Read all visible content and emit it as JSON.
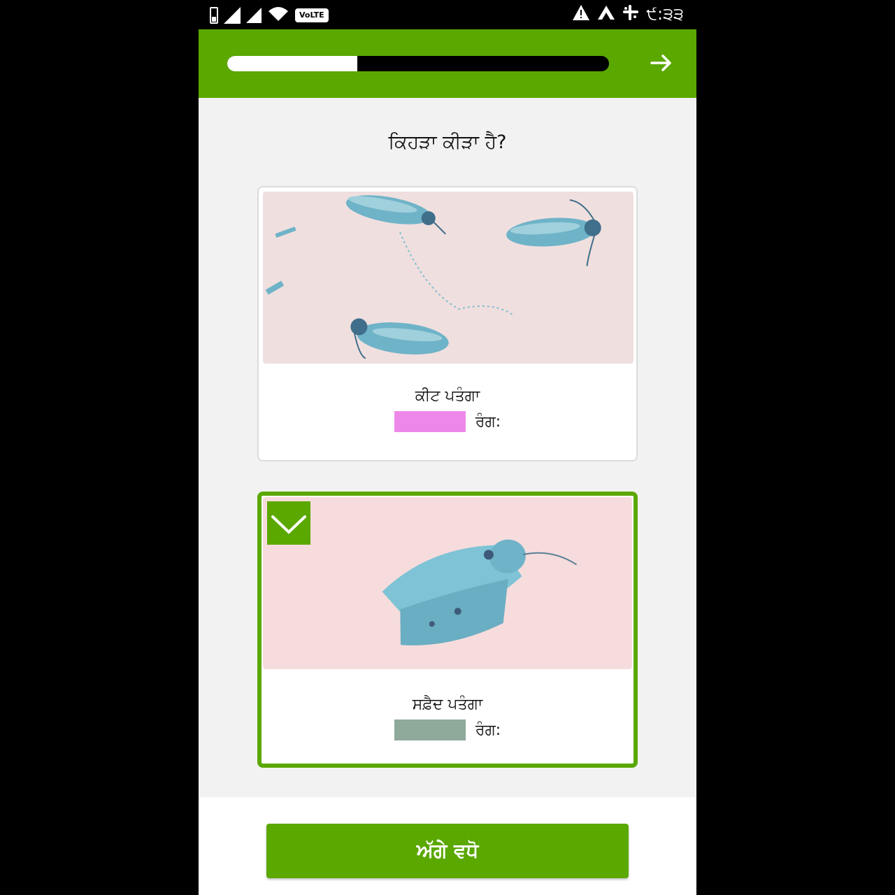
{
  "status_bar": {
    "network_badge": "VoLTE",
    "time": "੯:੩੩",
    "icons": [
      "battery-icon",
      "signal-icon",
      "signal-icon",
      "wifi-icon",
      "volte-icon",
      "warning-icon",
      "app-a-icon",
      "slack-icon"
    ]
  },
  "header": {
    "progress_fraction": 0.34,
    "next_icon": "arrow-right-icon"
  },
  "question": "ਕਿਹੜਾ ਕੀੜਾ ਹੈ?",
  "options": [
    {
      "name": "ਕੀਟ ਪਤੰਗਾ",
      "color_label": "ਰੰਗ:",
      "swatch_color": "#ee88e8",
      "selected": false
    },
    {
      "name": "ਸਫ਼ੈਦ ਪਤੰਗਾ",
      "color_label": "ਰੰਗ:",
      "swatch_color": "#8fa99a",
      "selected": true
    }
  ],
  "submit_label": "ਅੱਗੇ ਵਧੋ",
  "colors": {
    "brand_green": "#5aa800",
    "background": "#f2f2f2"
  }
}
